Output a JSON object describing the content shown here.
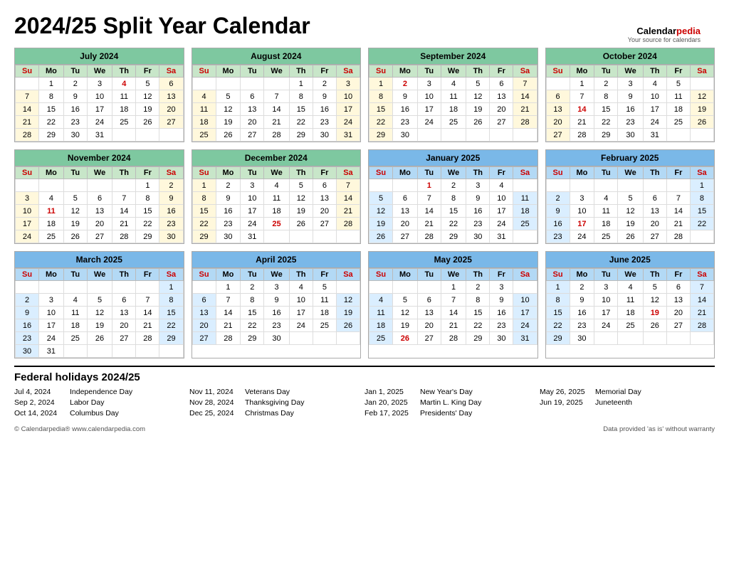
{
  "title": "2024/25 Split Year Calendar",
  "logo": {
    "text1": "Calendar",
    "text2": "pedia",
    "sub": "Your source for calendars"
  },
  "months": [
    {
      "name": "July 2024",
      "theme": "green",
      "startDay": 1,
      "days": 31,
      "holidays": [
        4
      ],
      "redDays": [
        4
      ],
      "weeks": [
        [
          "",
          "1",
          "2",
          "3",
          "4",
          "5",
          "6"
        ],
        [
          "7",
          "8",
          "9",
          "10",
          "11",
          "12",
          "13"
        ],
        [
          "14",
          "15",
          "16",
          "17",
          "18",
          "19",
          "20"
        ],
        [
          "21",
          "22",
          "23",
          "24",
          "25",
          "26",
          "27"
        ],
        [
          "28",
          "29",
          "30",
          "31",
          "",
          "",
          ""
        ]
      ]
    },
    {
      "name": "August 2024",
      "theme": "green",
      "startDay": 4,
      "days": 31,
      "weeks": [
        [
          "",
          "",
          "",
          "",
          "1",
          "2",
          "3"
        ],
        [
          "4",
          "5",
          "6",
          "7",
          "8",
          "9",
          "10"
        ],
        [
          "11",
          "12",
          "13",
          "14",
          "15",
          "16",
          "17"
        ],
        [
          "18",
          "19",
          "20",
          "21",
          "22",
          "23",
          "24"
        ],
        [
          "25",
          "26",
          "27",
          "28",
          "29",
          "30",
          "31"
        ]
      ]
    },
    {
      "name": "September 2024",
      "theme": "green",
      "startDay": 0,
      "days": 30,
      "redDays": [
        2
      ],
      "weeks": [
        [
          "1",
          "2",
          "3",
          "4",
          "5",
          "6",
          "7"
        ],
        [
          "8",
          "9",
          "10",
          "11",
          "12",
          "13",
          "14"
        ],
        [
          "15",
          "16",
          "17",
          "18",
          "19",
          "20",
          "21"
        ],
        [
          "22",
          "23",
          "24",
          "25",
          "26",
          "27",
          "28"
        ],
        [
          "29",
          "30",
          "",
          "",
          "",
          "",
          ""
        ]
      ]
    },
    {
      "name": "October 2024",
      "theme": "green",
      "startDay": 2,
      "days": 31,
      "redDays": [
        14
      ],
      "weeks": [
        [
          "",
          "1",
          "2",
          "3",
          "4",
          "5",
          ""
        ],
        [
          "6",
          "7",
          "8",
          "9",
          "10",
          "11",
          "12"
        ],
        [
          "13",
          "14",
          "15",
          "16",
          "17",
          "18",
          "19"
        ],
        [
          "20",
          "21",
          "22",
          "23",
          "24",
          "25",
          "26"
        ],
        [
          "27",
          "28",
          "29",
          "30",
          "31",
          "",
          ""
        ]
      ]
    },
    {
      "name": "November 2024",
      "theme": "green",
      "startDay": 5,
      "days": 30,
      "redDays": [
        11
      ],
      "weeks": [
        [
          "",
          "",
          "",
          "",
          "",
          "1",
          "2"
        ],
        [
          "3",
          "4",
          "5",
          "6",
          "7",
          "8",
          "9"
        ],
        [
          "10",
          "11",
          "12",
          "13",
          "14",
          "15",
          "16"
        ],
        [
          "17",
          "18",
          "19",
          "20",
          "21",
          "22",
          "23"
        ],
        [
          "24",
          "25",
          "26",
          "27",
          "28",
          "29",
          "30"
        ]
      ]
    },
    {
      "name": "December 2024",
      "theme": "green",
      "startDay": 0,
      "days": 31,
      "redDays": [
        25
      ],
      "weeks": [
        [
          "1",
          "2",
          "3",
          "4",
          "5",
          "6",
          "7"
        ],
        [
          "8",
          "9",
          "10",
          "11",
          "12",
          "13",
          "14"
        ],
        [
          "15",
          "16",
          "17",
          "18",
          "19",
          "20",
          "21"
        ],
        [
          "22",
          "23",
          "24",
          "25",
          "26",
          "27",
          "28"
        ],
        [
          "29",
          "30",
          "31",
          "",
          "",
          "",
          ""
        ]
      ]
    },
    {
      "name": "January 2025",
      "theme": "blue",
      "startDay": 3,
      "days": 31,
      "redDays": [
        1
      ],
      "weeks": [
        [
          "",
          "",
          "1",
          "2",
          "3",
          "4",
          ""
        ],
        [
          "5",
          "6",
          "7",
          "8",
          "9",
          "10",
          "11"
        ],
        [
          "12",
          "13",
          "14",
          "15",
          "16",
          "17",
          "18"
        ],
        [
          "19",
          "20",
          "21",
          "22",
          "23",
          "24",
          "25"
        ],
        [
          "26",
          "27",
          "28",
          "29",
          "30",
          "31",
          ""
        ]
      ]
    },
    {
      "name": "February 2025",
      "theme": "blue",
      "startDay": 6,
      "days": 28,
      "redDays": [
        17
      ],
      "weeks": [
        [
          "",
          "",
          "",
          "",
          "",
          "",
          "1"
        ],
        [
          "2",
          "3",
          "4",
          "5",
          "6",
          "7",
          "8"
        ],
        [
          "9",
          "10",
          "11",
          "12",
          "13",
          "14",
          "15"
        ],
        [
          "16",
          "17",
          "18",
          "19",
          "20",
          "21",
          "22"
        ],
        [
          "23",
          "24",
          "25",
          "26",
          "27",
          "28",
          ""
        ]
      ]
    },
    {
      "name": "March 2025",
      "theme": "blue",
      "startDay": 6,
      "days": 31,
      "weeks": [
        [
          "",
          "",
          "",
          "",
          "",
          "",
          "1"
        ],
        [
          "2",
          "3",
          "4",
          "5",
          "6",
          "7",
          "8"
        ],
        [
          "9",
          "10",
          "11",
          "12",
          "13",
          "14",
          "15"
        ],
        [
          "16",
          "17",
          "18",
          "19",
          "20",
          "21",
          "22"
        ],
        [
          "23",
          "24",
          "25",
          "26",
          "27",
          "28",
          "29"
        ],
        [
          "30",
          "31",
          "",
          "",
          "",
          "",
          ""
        ]
      ]
    },
    {
      "name": "April 2025",
      "theme": "blue",
      "startDay": 2,
      "days": 30,
      "weeks": [
        [
          "",
          "1",
          "2",
          "3",
          "4",
          "5",
          ""
        ],
        [
          "6",
          "7",
          "8",
          "9",
          "10",
          "11",
          "12"
        ],
        [
          "13",
          "14",
          "15",
          "16",
          "17",
          "18",
          "19"
        ],
        [
          "20",
          "21",
          "22",
          "23",
          "24",
          "25",
          "26"
        ],
        [
          "27",
          "28",
          "29",
          "30",
          "",
          "",
          ""
        ]
      ]
    },
    {
      "name": "May 2025",
      "theme": "blue",
      "startDay": 4,
      "days": 31,
      "redDays": [
        26
      ],
      "weeks": [
        [
          "",
          "",
          "",
          "1",
          "2",
          "3",
          ""
        ],
        [
          "4",
          "5",
          "6",
          "7",
          "8",
          "9",
          "10"
        ],
        [
          "11",
          "12",
          "13",
          "14",
          "15",
          "16",
          "17"
        ],
        [
          "18",
          "19",
          "20",
          "21",
          "22",
          "23",
          "24"
        ],
        [
          "25",
          "26",
          "27",
          "28",
          "29",
          "30",
          "31"
        ]
      ]
    },
    {
      "name": "June 2025",
      "theme": "blue",
      "startDay": 0,
      "days": 30,
      "redDays": [
        19
      ],
      "weeks": [
        [
          "1",
          "2",
          "3",
          "4",
          "5",
          "6",
          "7"
        ],
        [
          "8",
          "9",
          "10",
          "11",
          "12",
          "13",
          "14"
        ],
        [
          "15",
          "16",
          "17",
          "18",
          "19",
          "20",
          "21"
        ],
        [
          "22",
          "23",
          "24",
          "25",
          "26",
          "27",
          "28"
        ],
        [
          "29",
          "30",
          "",
          "",
          "",
          "",
          ""
        ]
      ]
    }
  ],
  "dayHeaders": [
    "Su",
    "Mo",
    "Tu",
    "We",
    "Th",
    "Fr",
    "Sa"
  ],
  "holidays": {
    "title": "Federal holidays 2024/25",
    "columns": [
      [
        {
          "date": "Jul 4, 2024",
          "name": "Independence Day"
        },
        {
          "date": "Sep 2, 2024",
          "name": "Labor Day"
        },
        {
          "date": "Oct 14, 2024",
          "name": "Columbus Day"
        }
      ],
      [
        {
          "date": "Nov 11, 2024",
          "name": "Veterans Day"
        },
        {
          "date": "Nov 28, 2024",
          "name": "Thanksgiving Day"
        },
        {
          "date": "Dec 25, 2024",
          "name": "Christmas Day"
        }
      ],
      [
        {
          "date": "Jan 1, 2025",
          "name": "New Year's Day"
        },
        {
          "date": "Jan 20, 2025",
          "name": "Martin L. King Day"
        },
        {
          "date": "Feb 17, 2025",
          "name": "Presidents' Day"
        }
      ],
      [
        {
          "date": "May 26, 2025",
          "name": "Memorial Day"
        },
        {
          "date": "Jun 19, 2025",
          "name": "Juneteenth"
        }
      ]
    ]
  },
  "footer": {
    "left": "© Calendarpedia®  www.calendarpedia.com",
    "right": "Data provided 'as is' without warranty"
  }
}
